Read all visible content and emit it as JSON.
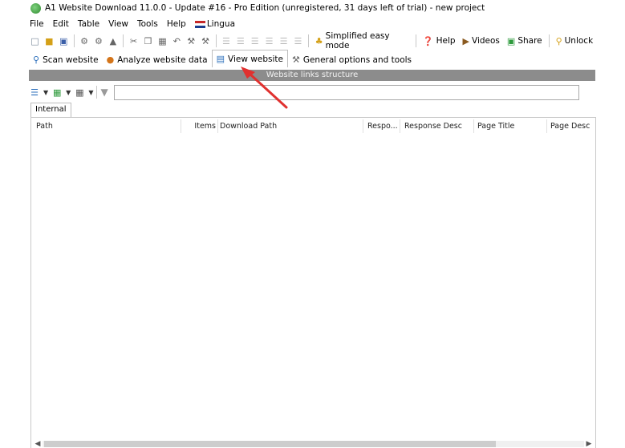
{
  "window": {
    "title": "A1 Website Download 11.0.0 - Update #16 - Pro Edition (unregistered, 31 days left of trial) - new project"
  },
  "menubar": {
    "items": [
      "File",
      "Edit",
      "Table",
      "View",
      "Tools",
      "Help"
    ],
    "lingua": "Lingua"
  },
  "toolbar": {
    "simplified": "Simplified easy mode",
    "help": "Help",
    "videos": "Videos",
    "share": "Share",
    "unlock": "Unlock"
  },
  "tabs": {
    "scan": "Scan website",
    "analyze": "Analyze website data",
    "view": "View website",
    "general": "General options and tools"
  },
  "panel": {
    "header": "Website links structure",
    "filter_value": "",
    "subtab": "Internal"
  },
  "grid": {
    "columns": [
      "Path",
      "Items",
      "Download Path",
      "Respo...",
      "Response Desc",
      "Page Title",
      "Page Desc"
    ]
  },
  "colors": {
    "panel_header_bg": "#8c8c8c",
    "arrow": "#e0312f"
  },
  "icons": [
    "app-icon",
    "new-icon",
    "open-icon",
    "save-icon",
    "flag-icon",
    "scan-icon",
    "analyze-icon",
    "view-icon",
    "tools-icon",
    "funnel-icon"
  ]
}
